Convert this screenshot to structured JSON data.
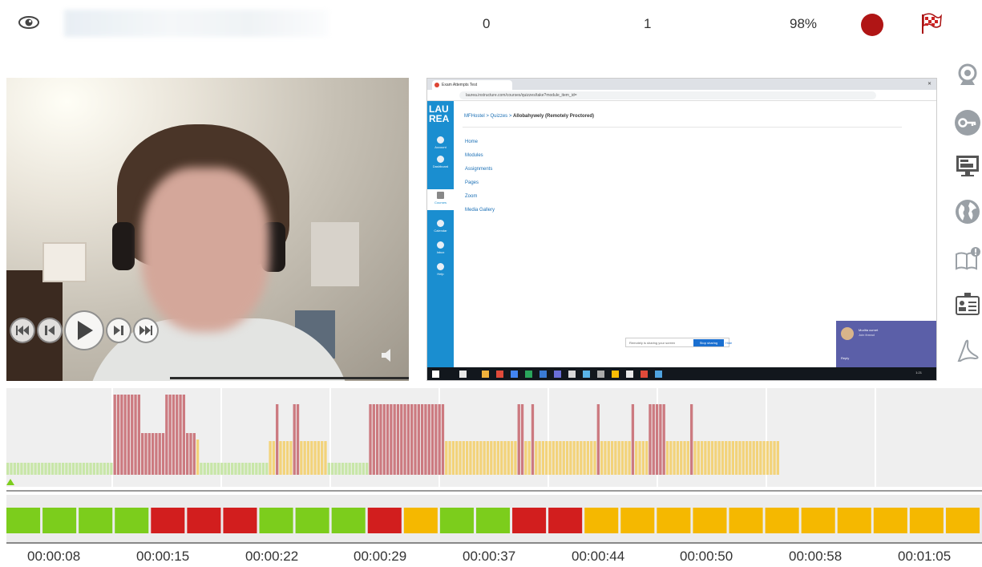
{
  "header": {
    "count_a": "0",
    "count_b": "1",
    "percent": "98%"
  },
  "colors": {
    "record": "#b01515",
    "green": "#7ccd1c",
    "red": "#d21e1e",
    "amber": "#f5b800",
    "bar_red": "#cc7a80",
    "bar_yellow": "#f3d37a",
    "bar_green": "#c8e6a8"
  },
  "icons": {
    "header": [
      "eye-icon",
      "record-indicator",
      "checkered-flag-icon"
    ],
    "player": [
      "skip-start-icon",
      "step-back-icon",
      "play-icon",
      "step-forward-icon",
      "skip-end-icon",
      "speaker-icon"
    ],
    "sidebar": [
      "webcam-icon",
      "key-icon",
      "monitor-icon",
      "globe-icon",
      "book-alert-icon",
      "id-card-icon",
      "pdf-icon"
    ]
  },
  "screen": {
    "tab_title": "Exam Attempts Test",
    "url": "laurea.instructure.com/courses/quizzes/take?module_item_id=",
    "logo_line1": "LAU",
    "logo_line2": "REA",
    "nav": [
      "Account",
      "Dashboard",
      "Courses",
      "Calendar",
      "Inbox",
      "Help"
    ],
    "crumb_links": "MFHostel  >  Quizzes  >",
    "crumb_current": "Allobahywely (Remotely Proctored)",
    "menu": [
      "Home",
      "Modules",
      "Assignments",
      "Pages",
      "Zoom",
      "Media Gallery"
    ],
    "proctor_msg": "Remotely is sharing your screen",
    "stop_sharing": "Stop sharing",
    "hide": "Hide",
    "chat_title": "Mudita curnet",
    "chat_sub": "Join thread",
    "chat_reply": "Reply",
    "clock": "1:21"
  },
  "timeline": {
    "labels": [
      "00:00:08",
      "00:00:15",
      "00:00:22",
      "00:00:29",
      "00:00:37",
      "00:00:44",
      "00:00:50",
      "00:00:58",
      "00:01:05"
    ]
  },
  "activity": {
    "bars": [
      [
        "g",
        0.15
      ],
      [
        "g",
        0.15
      ],
      [
        "g",
        0.15
      ],
      [
        "g",
        0.15
      ],
      [
        "g",
        0.15
      ],
      [
        "g",
        0.15
      ],
      [
        "g",
        0.15
      ],
      [
        "g",
        0.15
      ],
      [
        "g",
        0.15
      ],
      [
        "g",
        0.15
      ],
      [
        "g",
        0.15
      ],
      [
        "g",
        0.15
      ],
      [
        "g",
        0.15
      ],
      [
        "g",
        0.15
      ],
      [
        "g",
        0.15
      ],
      [
        "g",
        0.15
      ],
      [
        "g",
        0.15
      ],
      [
        "g",
        0.15
      ],
      [
        "g",
        0.15
      ],
      [
        "g",
        0.15
      ],
      [
        "g",
        0.15
      ],
      [
        "g",
        0.15
      ],
      [
        "g",
        0.15
      ],
      [
        "g",
        0.15
      ],
      [
        "g",
        0.15
      ],
      [
        "g",
        0.15
      ],
      [
        "g",
        0.15
      ],
      [
        "g",
        0.15
      ],
      [
        "g",
        0.15
      ],
      [
        "g",
        0.15
      ],
      [
        "g",
        0.15
      ],
      [
        "r",
        1.0
      ],
      [
        "r",
        1.0
      ],
      [
        "r",
        1.0
      ],
      [
        "r",
        1.0
      ],
      [
        "r",
        1.0
      ],
      [
        "r",
        1.0
      ],
      [
        "r",
        1.0
      ],
      [
        "r",
        1.0
      ],
      [
        "r",
        0.52
      ],
      [
        "r",
        0.52
      ],
      [
        "r",
        0.52
      ],
      [
        "r",
        0.52
      ],
      [
        "r",
        0.52
      ],
      [
        "r",
        0.52
      ],
      [
        "r",
        0.52
      ],
      [
        "r",
        1.0
      ],
      [
        "r",
        1.0
      ],
      [
        "r",
        1.0
      ],
      [
        "r",
        1.0
      ],
      [
        "r",
        1.0
      ],
      [
        "r",
        1.0
      ],
      [
        "r",
        0.52
      ],
      [
        "r",
        0.52
      ],
      [
        "r",
        0.52
      ],
      [
        "y",
        0.44
      ],
      [
        "g",
        0.15
      ],
      [
        "g",
        0.15
      ],
      [
        "g",
        0.15
      ],
      [
        "g",
        0.15
      ],
      [
        "g",
        0.15
      ],
      [
        "g",
        0.15
      ],
      [
        "g",
        0.15
      ],
      [
        "g",
        0.15
      ],
      [
        "g",
        0.15
      ],
      [
        "g",
        0.15
      ],
      [
        "g",
        0.15
      ],
      [
        "g",
        0.15
      ],
      [
        "g",
        0.15
      ],
      [
        "g",
        0.15
      ],
      [
        "g",
        0.15
      ],
      [
        "g",
        0.15
      ],
      [
        "g",
        0.15
      ],
      [
        "g",
        0.15
      ],
      [
        "g",
        0.15
      ],
      [
        "g",
        0.15
      ],
      [
        "y",
        0.42
      ],
      [
        "y",
        0.42
      ],
      [
        "r",
        0.88
      ],
      [
        "y",
        0.42
      ],
      [
        "y",
        0.42
      ],
      [
        "y",
        0.42
      ],
      [
        "y",
        0.42
      ],
      [
        "r",
        0.88
      ],
      [
        "r",
        0.88
      ],
      [
        "y",
        0.42
      ],
      [
        "y",
        0.42
      ],
      [
        "y",
        0.42
      ],
      [
        "y",
        0.42
      ],
      [
        "y",
        0.42
      ],
      [
        "y",
        0.42
      ],
      [
        "y",
        0.42
      ],
      [
        "y",
        0.42
      ],
      [
        "g",
        0.15
      ],
      [
        "g",
        0.15
      ],
      [
        "g",
        0.15
      ],
      [
        "g",
        0.15
      ],
      [
        "g",
        0.15
      ],
      [
        "g",
        0.15
      ],
      [
        "g",
        0.15
      ],
      [
        "g",
        0.15
      ],
      [
        "g",
        0.15
      ],
      [
        "g",
        0.15
      ],
      [
        "g",
        0.15
      ],
      [
        "g",
        0.15
      ],
      [
        "r",
        0.88
      ],
      [
        "r",
        0.88
      ],
      [
        "r",
        0.88
      ],
      [
        "r",
        0.88
      ],
      [
        "r",
        0.88
      ],
      [
        "r",
        0.88
      ],
      [
        "r",
        0.88
      ],
      [
        "r",
        0.88
      ],
      [
        "r",
        0.88
      ],
      [
        "r",
        0.88
      ],
      [
        "r",
        0.88
      ],
      [
        "r",
        0.88
      ],
      [
        "r",
        0.88
      ],
      [
        "r",
        0.88
      ],
      [
        "r",
        0.88
      ],
      [
        "r",
        0.88
      ],
      [
        "r",
        0.88
      ],
      [
        "r",
        0.88
      ],
      [
        "r",
        0.88
      ],
      [
        "r",
        0.88
      ],
      [
        "r",
        0.88
      ],
      [
        "r",
        0.88
      ],
      [
        "y",
        0.42
      ],
      [
        "y",
        0.42
      ],
      [
        "y",
        0.42
      ],
      [
        "y",
        0.42
      ],
      [
        "y",
        0.42
      ],
      [
        "y",
        0.42
      ],
      [
        "y",
        0.42
      ],
      [
        "y",
        0.42
      ],
      [
        "y",
        0.42
      ],
      [
        "y",
        0.42
      ],
      [
        "y",
        0.42
      ],
      [
        "y",
        0.42
      ],
      [
        "y",
        0.42
      ],
      [
        "y",
        0.42
      ],
      [
        "y",
        0.42
      ],
      [
        "y",
        0.42
      ],
      [
        "y",
        0.42
      ],
      [
        "y",
        0.42
      ],
      [
        "y",
        0.42
      ],
      [
        "y",
        0.42
      ],
      [
        "y",
        0.42
      ],
      [
        "r",
        0.88
      ],
      [
        "r",
        0.88
      ],
      [
        "y",
        0.42
      ],
      [
        "y",
        0.42
      ],
      [
        "r",
        0.88
      ],
      [
        "y",
        0.42
      ],
      [
        "y",
        0.42
      ],
      [
        "y",
        0.42
      ],
      [
        "y",
        0.42
      ],
      [
        "y",
        0.42
      ],
      [
        "y",
        0.42
      ],
      [
        "y",
        0.42
      ],
      [
        "y",
        0.42
      ],
      [
        "y",
        0.42
      ],
      [
        "y",
        0.42
      ],
      [
        "y",
        0.42
      ],
      [
        "y",
        0.42
      ],
      [
        "y",
        0.42
      ],
      [
        "y",
        0.42
      ],
      [
        "y",
        0.42
      ],
      [
        "y",
        0.42
      ],
      [
        "y",
        0.42
      ],
      [
        "y",
        0.42
      ],
      [
        "r",
        0.88
      ],
      [
        "y",
        0.42
      ],
      [
        "y",
        0.42
      ],
      [
        "y",
        0.42
      ],
      [
        "y",
        0.42
      ],
      [
        "y",
        0.42
      ],
      [
        "y",
        0.42
      ],
      [
        "y",
        0.42
      ],
      [
        "y",
        0.42
      ],
      [
        "y",
        0.42
      ],
      [
        "r",
        0.88
      ],
      [
        "y",
        0.42
      ],
      [
        "y",
        0.42
      ],
      [
        "y",
        0.42
      ],
      [
        "y",
        0.42
      ],
      [
        "r",
        0.88
      ],
      [
        "r",
        0.88
      ],
      [
        "r",
        0.88
      ],
      [
        "r",
        0.88
      ],
      [
        "r",
        0.88
      ],
      [
        "y",
        0.42
      ],
      [
        "y",
        0.42
      ],
      [
        "y",
        0.42
      ],
      [
        "y",
        0.42
      ],
      [
        "y",
        0.42
      ],
      [
        "y",
        0.42
      ],
      [
        "y",
        0.42
      ],
      [
        "r",
        0.88
      ],
      [
        "y",
        0.42
      ],
      [
        "y",
        0.42
      ],
      [
        "y",
        0.42
      ],
      [
        "y",
        0.42
      ],
      [
        "y",
        0.42
      ],
      [
        "y",
        0.42
      ],
      [
        "y",
        0.42
      ],
      [
        "y",
        0.42
      ],
      [
        "y",
        0.42
      ],
      [
        "y",
        0.42
      ],
      [
        "y",
        0.42
      ],
      [
        "y",
        0.42
      ],
      [
        "y",
        0.42
      ],
      [
        "y",
        0.42
      ],
      [
        "y",
        0.42
      ],
      [
        "y",
        0.42
      ],
      [
        "y",
        0.42
      ],
      [
        "y",
        0.42
      ],
      [
        "y",
        0.42
      ],
      [
        "y",
        0.42
      ],
      [
        "y",
        0.42
      ],
      [
        "y",
        0.42
      ],
      [
        "y",
        0.42
      ],
      [
        "y",
        0.42
      ],
      [
        "y",
        0.42
      ]
    ]
  },
  "status_strip": [
    "green",
    "green",
    "green",
    "green",
    "red",
    "red",
    "red",
    "green",
    "green",
    "green",
    "red",
    "amber",
    "green",
    "green",
    "red",
    "red",
    "amber",
    "amber",
    "amber",
    "amber",
    "amber",
    "amber",
    "amber",
    "amber",
    "amber",
    "amber",
    "amber"
  ]
}
